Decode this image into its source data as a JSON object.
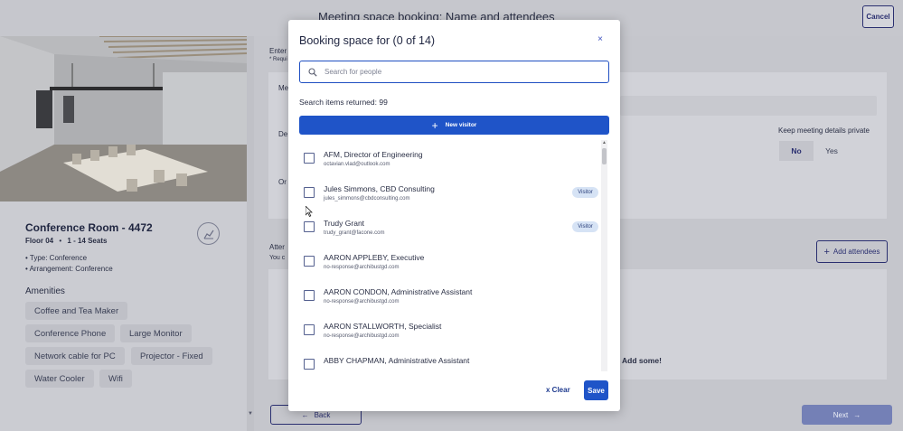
{
  "page": {
    "title": "Meeting space booking: Name and attendees",
    "cancel_label": "Cancel"
  },
  "room": {
    "name": "Conference Room - 4472",
    "floor": "Floor 04",
    "separator": "•",
    "seats": "1 - 14 Seats",
    "type": "Type: Conference",
    "arrangement": "Arrangement: Conference",
    "amenities_title": "Amenities",
    "amenities": [
      "Coffee and Tea Maker",
      "Conference Phone",
      "Large Monitor",
      "Network cable for PC",
      "Projector - Fixed",
      "Water Cooler",
      "Wifi"
    ]
  },
  "form": {
    "enter_label": "Enter",
    "required_label": "* Requi",
    "field1_label": "Me",
    "field2_label": "De",
    "field3_label": "Or",
    "keep_private_label": "Keep meeting details private",
    "toggle_no": "No",
    "toggle_yes": "Yes",
    "attendees_label": "Atter",
    "attendees_sub": "You c",
    "add_attendees_label": "Add attendees",
    "add_some_label": "Add some!",
    "back_label": "Back",
    "next_label": "Next"
  },
  "modal": {
    "title": "Booking space for (0 of 14)",
    "close_glyph": "×",
    "search_placeholder": "Search for people",
    "search_value": "",
    "results_text": "Search items returned: 99",
    "new_visitor_label": "New visitor",
    "clear_label": "x Clear",
    "save_label": "Save",
    "people": [
      {
        "name": "AFM, Director of Engineering",
        "email": "octavian.vlad@outlook.com",
        "badge": ""
      },
      {
        "name": "Jules Simmons, CBD Consulting",
        "email": "jules_simmons@cbdconsulting.com",
        "badge": "Visitor"
      },
      {
        "name": "Trudy Grant",
        "email": "trudy_grant@facone.com",
        "badge": "Visitor"
      },
      {
        "name": "AARON APPLEBY, Executive",
        "email": "no-response@archibustgd.com",
        "badge": ""
      },
      {
        "name": "AARON CONDON, Administrative Assistant",
        "email": "no-response@archibustgd.com",
        "badge": ""
      },
      {
        "name": "AARON STALLWORTH, Specialist",
        "email": "no-response@archibustgd.com",
        "badge": ""
      },
      {
        "name": "ABBY CHAPMAN, Administrative Assistant",
        "email": "",
        "badge": ""
      }
    ]
  }
}
